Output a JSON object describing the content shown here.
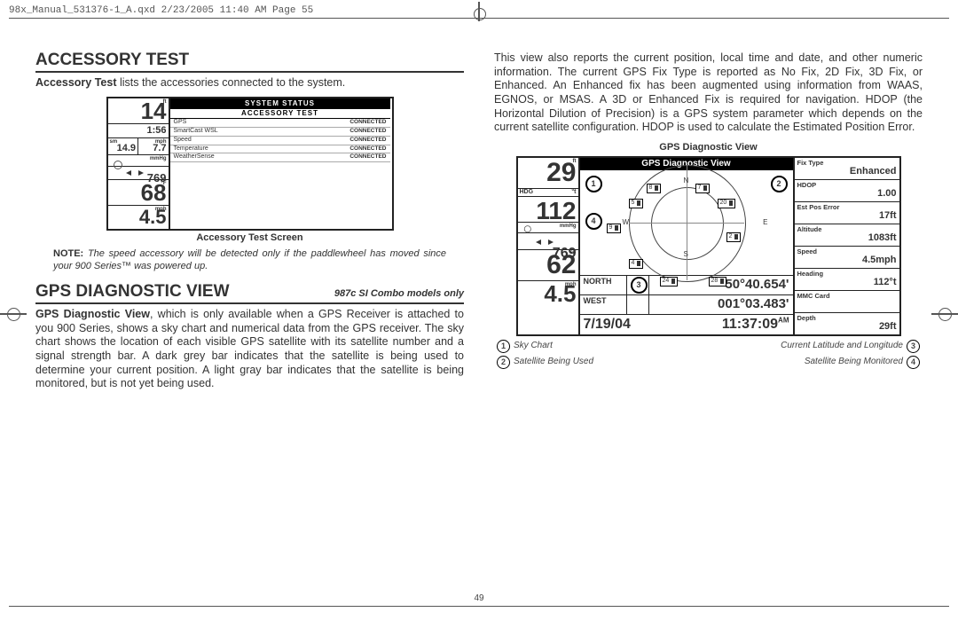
{
  "print_header": "98x_Manual_531376-1_A.qxd  2/23/2005  11:40 AM  Page 55",
  "page_number": "49",
  "col1": {
    "title1": "Accessory Test",
    "intro_bold": "Accessory Test",
    "intro_rest": " lists the accessories connected to the system.",
    "caption1": "Accessory Test Screen",
    "note_label": "NOTE:",
    "note_text": " The speed accessory will be detected only if the paddlewheel has moved since your 900 Series™ was powered up.",
    "title2": "Gps Diagnostic View",
    "title2_sub": "987c SI Combo models only",
    "gps_bold": "GPS Diagnostic View",
    "gps_body": ", which is only available when a GPS Receiver is attached to you 900 Series, shows a sky chart and numerical data from the GPS receiver. The sky chart shows the location of each visible GPS satellite with its satellite number and a signal strength bar. A dark grey bar indicates that the satellite is being used to determine your current position. A light gray bar indicates that the satellite is being monitored, but is not yet being used."
  },
  "col2": {
    "body": "This view also reports the current position, local time and date, and other numeric information. The current GPS Fix Type is reported as No Fix, 2D Fix, 3D Fix, or Enhanced. An Enhanced fix has been augmented using information from WAAS, EGNOS, or MSAS. A 3D or Enhanced Fix is required for navigation. HDOP (the Horizontal Dilution of Precision) is a GPS system parameter which depends on the current satellite configuration. HDOP is used to calculate the Estimated Position Error.",
    "caption2": "GPS Diagnostic View",
    "legend": {
      "l1": "Sky Chart",
      "l2": "Satellite Being Used",
      "r1": "Current Latitude and Longitude",
      "r2": "Satellite Being Monitored"
    }
  },
  "acc_screen": {
    "sysbar": "SYSTEM STATUS",
    "titlebar": "ACCESSORY TEST",
    "big_top": "14",
    "big_top_unit": "ft",
    "time": "1:56",
    "sm": "sm",
    "mph": "mph",
    "sm_val": "14.9",
    "mph_val": "7.7",
    "mmhg_val": "769",
    "mmhg": "mmHg",
    "temp": "68",
    "temp_unit": "°F",
    "speed": "4.5",
    "speed_unit": "mph",
    "rows": [
      {
        "n": "GPS",
        "s": "CONNECTED"
      },
      {
        "n": "SmartCast WSL",
        "s": "CONNECTED"
      },
      {
        "n": "Speed",
        "s": "CONNECTED"
      },
      {
        "n": "Temperature",
        "s": "CONNECTED"
      },
      {
        "n": "WeatherSense",
        "s": "CONNECTED"
      }
    ]
  },
  "gps_screen": {
    "titlebar": "GPS Diagnostic View",
    "big1": "29",
    "u1": "ft",
    "hdg": "HDG",
    "u_t": "°t",
    "big2": "112",
    "mmhg": "mmHg",
    "mmhg_v": "769",
    "temp": "62",
    "temp_u": "°F",
    "spd": "4.5",
    "spd_u": "mph",
    "north": "NORTH",
    "north_v": "50°40.654'",
    "west": "WEST",
    "west_v": "001°03.483'",
    "date": "7/19/04",
    "time": "11:37:09",
    "ampm": "AM",
    "sats": [
      "8",
      "7",
      "5",
      "20",
      "9",
      "2",
      "4",
      "24",
      "28"
    ],
    "compass": {
      "n": "N",
      "s": "S",
      "e": "E",
      "w": "W"
    },
    "info": [
      {
        "lab": "Fix Type",
        "val": "Enhanced"
      },
      {
        "lab": "HDOP",
        "val": "1.00"
      },
      {
        "lab": "Est Pos Error",
        "val": "17ft"
      },
      {
        "lab": "Altitude",
        "val": "1083ft"
      },
      {
        "lab": "Speed",
        "val": "4.5mph"
      },
      {
        "lab": "Heading",
        "val": "112°t"
      },
      {
        "lab": "MMC Card",
        "val": ""
      },
      {
        "lab": "Depth",
        "val": "29ft"
      }
    ]
  }
}
